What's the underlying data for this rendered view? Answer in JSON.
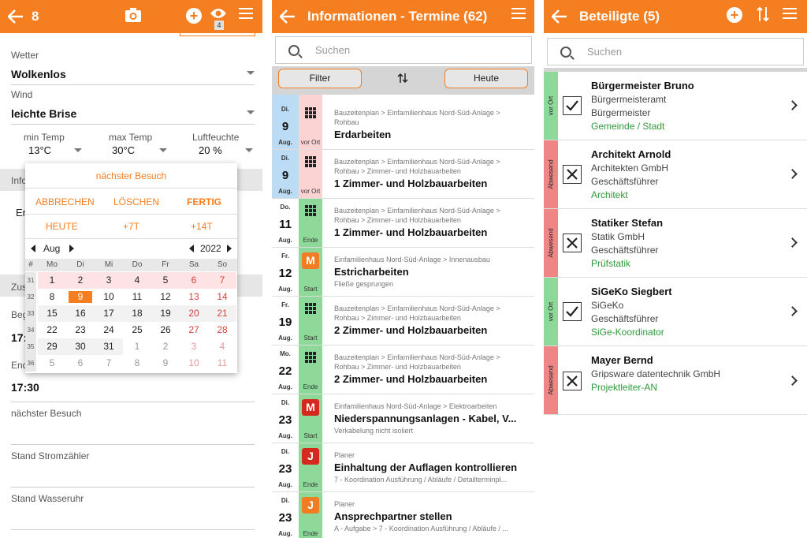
{
  "colors": {
    "accent": "#f47e20",
    "green": "#8ed99a",
    "red": "#f08585",
    "blue": "#bcdcf6",
    "pink": "#fbd3d3",
    "letter_orange": "#f07d24",
    "letter_red": "#d5281e",
    "role_green": "#2e9a3c"
  },
  "screen1": {
    "header_number": "8",
    "badge_count": "4",
    "fields": [
      {
        "label": "Wetter",
        "value": "Wolkenlos"
      },
      {
        "label": "Wind",
        "value": "leichte Brise"
      }
    ],
    "temps": [
      {
        "label": "min Temp",
        "value": "13°C"
      },
      {
        "label": "max Temp",
        "value": "30°C"
      },
      {
        "label": "Luftfeuchte",
        "value": "20 %"
      }
    ],
    "partial_labels": [
      "Info",
      "Er",
      "Zus",
      "Beg",
      "17:",
      "End"
    ],
    "end_time": "17:30",
    "lower_fields": [
      "nächster Besuch",
      "Stand Stromzähler",
      "Stand Wasseruhr"
    ],
    "dialog": {
      "title": "nächster Besuch",
      "cancel": "ABBRECHEN",
      "delete": "LÖSCHEN",
      "done": "FERTIG",
      "today": "HEUTE",
      "plus7": "+7T",
      "plus14": "+14T",
      "month": "Aug",
      "year": "2022",
      "week_header": "#",
      "weekdays": [
        "Mo",
        "Di",
        "Mi",
        "Do",
        "Fr",
        "Sa",
        "So"
      ],
      "weeks": [
        {
          "wk": "31",
          "days": [
            "1",
            "2",
            "3",
            "4",
            "5",
            "6",
            "7"
          ]
        },
        {
          "wk": "32",
          "days": [
            "8",
            "9",
            "10",
            "11",
            "12",
            "13",
            "14"
          ]
        },
        {
          "wk": "33",
          "days": [
            "15",
            "16",
            "17",
            "18",
            "19",
            "20",
            "21"
          ]
        },
        {
          "wk": "34",
          "days": [
            "22",
            "23",
            "24",
            "25",
            "26",
            "27",
            "28"
          ]
        },
        {
          "wk": "35",
          "days": [
            "29",
            "30",
            "31",
            "1",
            "2",
            "3",
            "4"
          ]
        },
        {
          "wk": "36",
          "days": [
            "5",
            "6",
            "7",
            "8",
            "9",
            "10",
            "11"
          ]
        }
      ]
    }
  },
  "screen2": {
    "title": "Informationen - Termine (62)",
    "search_placeholder": "Suchen",
    "filter_label": "Filter",
    "today_label": "Heute",
    "partial_top": "Aug.",
    "rows": [
      {
        "dow": "Di.",
        "day": "9",
        "mon": "Aug.",
        "status": "vor Ort",
        "path": "Bauzeitenplan > Einfamilienhaus Nord-Süd-Anlage > Rohbau",
        "title": "Erdarbeiten",
        "sub": "",
        "icon": "grid",
        "datebg": "blue",
        "statbg": "pink"
      },
      {
        "dow": "Di.",
        "day": "9",
        "mon": "Aug.",
        "status": "vor Ort",
        "path": "Bauzeitenplan > Einfamilienhaus Nord-Süd-Anlage > Rohbau > Zimmer- und Holzbauarbeiten",
        "title": "1 Zimmer- und Holzbauarbeiten",
        "sub": "",
        "icon": "grid",
        "datebg": "blue",
        "statbg": "pink"
      },
      {
        "dow": "Do.",
        "day": "11",
        "mon": "Aug.",
        "status": "Ende",
        "path": "Bauzeitenplan > Einfamilienhaus Nord-Süd-Anlage > Rohbau > Zimmer- und Holzbauarbeiten",
        "title": "1 Zimmer- und Holzbauarbeiten",
        "sub": "",
        "icon": "grid",
        "datebg": "white",
        "statbg": "green"
      },
      {
        "dow": "Fr.",
        "day": "12",
        "mon": "Aug.",
        "status": "Start",
        "path": "Einfamilienhaus Nord-Süd-Anlage > Innenausbau",
        "title": "Estricharbeiten",
        "sub": "Fließe gesprungen",
        "icon": "M",
        "letterbg": "orange",
        "datebg": "white",
        "statbg": "green"
      },
      {
        "dow": "Fr.",
        "day": "19",
        "mon": "Aug.",
        "status": "Start",
        "path": "Bauzeitenplan > Einfamilienhaus Nord-Süd-Anlage > Rohbau > Zimmer- und Holzbauarbeiten",
        "title": "2 Zimmer- und Holzbauarbeiten",
        "sub": "",
        "icon": "grid",
        "datebg": "white",
        "statbg": "green"
      },
      {
        "dow": "Mo.",
        "day": "22",
        "mon": "Aug.",
        "status": "Ende",
        "path": "Bauzeitenplan > Einfamilienhaus Nord-Süd-Anlage > Rohbau > Zimmer- und Holzbauarbeiten",
        "title": "2 Zimmer- und Holzbauarbeiten",
        "sub": "",
        "icon": "grid",
        "datebg": "white",
        "statbg": "green"
      },
      {
        "dow": "Di.",
        "day": "23",
        "mon": "Aug.",
        "status": "Start",
        "path": "Einfamilienhaus Nord-Süd-Anlage > Elektroarbeiten",
        "title": "Niederspannungsanlagen - Kabel, V...",
        "sub": "Verkabelung nicht isoliert",
        "icon": "M",
        "letterbg": "red",
        "datebg": "white",
        "statbg": "green"
      },
      {
        "dow": "Di.",
        "day": "23",
        "mon": "Aug.",
        "status": "Ende",
        "path": "Planer",
        "title": "Einhaltung der Auflagen kontrollieren",
        "sub": "7 - Koordination Ausführung / Abläufe / Detailterminpl...",
        "icon": "J",
        "letterbg": "red",
        "datebg": "white",
        "statbg": "green"
      },
      {
        "dow": "Di.",
        "day": "23",
        "mon": "Aug.",
        "status": "Ende",
        "path": "Planer",
        "title": "Ansprechpartner stellen",
        "sub": "A - Aufgabe > 7 - Koordination Ausführung / Abläufe / ...",
        "icon": "J",
        "letterbg": "orange",
        "datebg": "white",
        "statbg": "green"
      }
    ]
  },
  "screen3": {
    "title": "Beteiligte (5)",
    "search_placeholder": "Suchen",
    "people": [
      {
        "status": "vor Ort",
        "checked": true,
        "name": "Bürgermeister Bruno",
        "lines": [
          "Bürgermeisteramt",
          "Bürgermeister"
        ],
        "role": "Gemeinde / Stadt"
      },
      {
        "status": "Abwesend",
        "checked": false,
        "name": "Architekt Arnold",
        "lines": [
          "Architekten GmbH",
          "Geschäftsführer"
        ],
        "role": "Architekt"
      },
      {
        "status": "Abwesend",
        "checked": false,
        "name": "Statiker Stefan",
        "lines": [
          "Statik GmbH",
          "Geschäftsführer"
        ],
        "role": "Prüfstatik"
      },
      {
        "status": "vor Ort",
        "checked": true,
        "name": "SiGeKo Siegbert",
        "lines": [
          "SiGeKo",
          "Geschäftsführer"
        ],
        "role": "SiGe-Koordinator"
      },
      {
        "status": "Abwesend",
        "checked": false,
        "name": "Mayer Bernd",
        "lines": [
          "Gripsware datentechnik GmbH"
        ],
        "role": "Projektleiter-AN"
      }
    ]
  }
}
